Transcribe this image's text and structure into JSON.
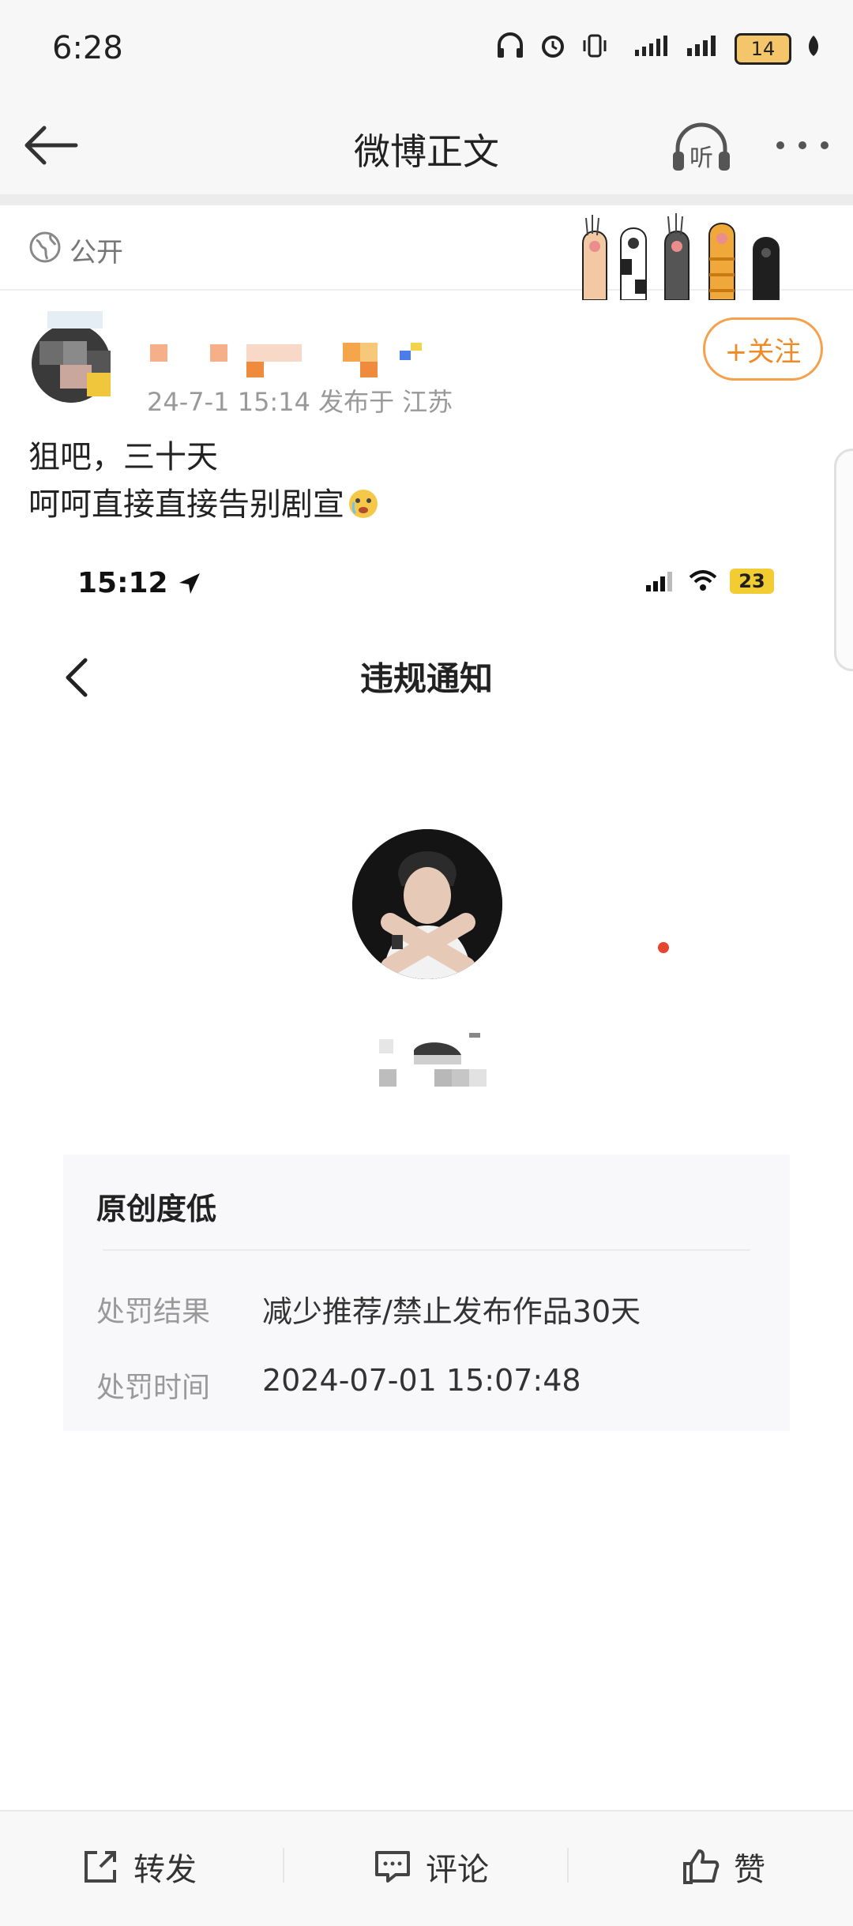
{
  "status_bar": {
    "time": "6:28",
    "battery": "14"
  },
  "header": {
    "title": "微博正文",
    "listen_label": "听"
  },
  "visibility": {
    "label": "公开"
  },
  "post": {
    "meta": "24-7-1 15:14  发布于 江苏",
    "follow_label": "+关注",
    "line1": "狙吧，三十天",
    "line2": "呵呵直接直接告别剧宣"
  },
  "embedded": {
    "time": "15:12",
    "battery": "23",
    "title": "违规通知",
    "card": {
      "title": "原创度低",
      "rows": [
        {
          "label": "处罚结果",
          "value": "减少推荐/禁止发布作品30天"
        },
        {
          "label": "处罚时间",
          "value": "2024-07-01 15:07:48"
        }
      ]
    }
  },
  "actions": {
    "repost": "转发",
    "comment": "评论",
    "like": "赞"
  },
  "colors": {
    "accent": "#f08a24",
    "follow_border": "#f5a04a",
    "dot": "#e8452f",
    "battery_embedded": "#f2cc33"
  }
}
